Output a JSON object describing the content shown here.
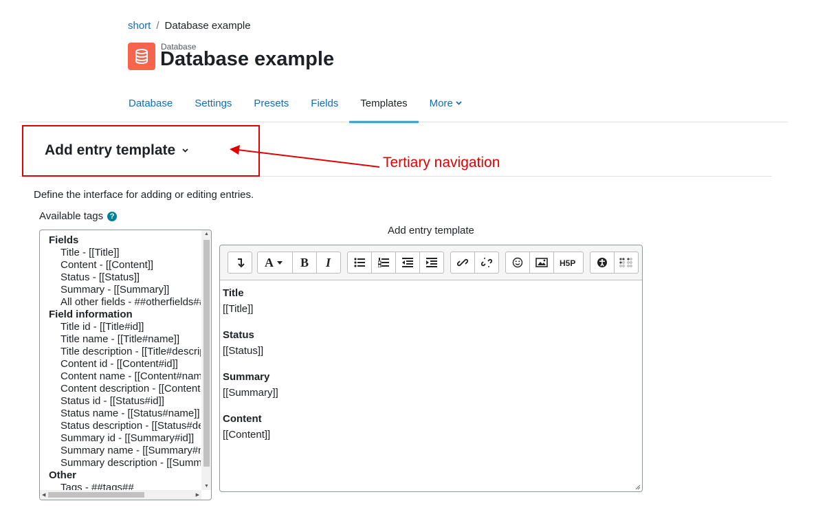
{
  "breadcrumb": {
    "course": "short",
    "separator": "/",
    "current": "Database example"
  },
  "header": {
    "module_type": "Database",
    "title": "Database example",
    "icon": "database-icon",
    "icon_color": "#f7634d"
  },
  "nav": {
    "tabs": [
      {
        "label": "Database",
        "active": false
      },
      {
        "label": "Settings",
        "active": false
      },
      {
        "label": "Presets",
        "active": false
      },
      {
        "label": "Fields",
        "active": false
      },
      {
        "label": "Templates",
        "active": true
      },
      {
        "label": "More",
        "active": false
      }
    ]
  },
  "tertiary": {
    "label": "Add entry template"
  },
  "annotation": {
    "text": "Tertiary navigation",
    "color": "#e00000"
  },
  "description": "Define the interface for adding or editing entries.",
  "available_tags": {
    "label": "Available tags",
    "help": "?"
  },
  "tags": {
    "fields_heading": "Fields",
    "fields": [
      "Title - [[Title]]",
      "Content - [[Content]]",
      "Status - [[Status]]",
      "Summary - [[Summary]]",
      "All other fields - ##otherfields##"
    ],
    "info_heading": "Field information",
    "info": [
      "Title id - [[Title#id]]",
      "Title name - [[Title#name]]",
      "Title description - [[Title#description]]",
      "Content id - [[Content#id]]",
      "Content name - [[Content#name]]",
      "Content description - [[Content#description]]",
      "Status id - [[Status#id]]",
      "Status name - [[Status#name]]",
      "Status description - [[Status#description]]",
      "Summary id - [[Summary#id]]",
      "Summary name - [[Summary#name]]",
      "Summary description - [[Summary#description]]"
    ],
    "other_heading": "Other",
    "other": [
      "Tags - ##tags##"
    ]
  },
  "editor": {
    "label": "Add entry template",
    "content": [
      {
        "heading": "Title",
        "value": "[[Title]]"
      },
      {
        "heading": "Status",
        "value": "[[Status]]"
      },
      {
        "heading": "Summary",
        "value": "[[Summary]]"
      },
      {
        "heading": "Content",
        "value": "[[Content]]"
      }
    ]
  },
  "accent_color": "#0f6cbf"
}
